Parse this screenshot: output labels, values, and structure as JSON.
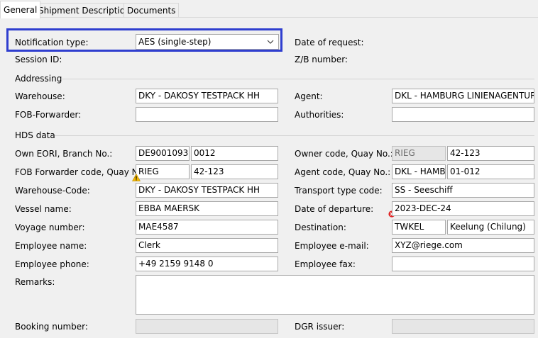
{
  "tabs": [
    {
      "label": "General"
    },
    {
      "label": "Shipment Description"
    },
    {
      "label": "Documents"
    }
  ],
  "header": {
    "notification_type_label": "Notification type:",
    "notification_type_value": "AES (single-step)",
    "session_id_label": "Session ID:",
    "date_of_request_label": "Date of request:",
    "zb_number_label": "Z/B number:"
  },
  "addressing": {
    "section_title": "Addressing",
    "warehouse_label": "Warehouse:",
    "warehouse_value": "DKY - DAKOSY TESTPACK HH",
    "agent_label": "Agent:",
    "agent_value": "DKL - HAMBURG LINIENAGENTUR (T",
    "fob_forwarder_label": "FOB-Forwarder:",
    "fob_forwarder_value": "",
    "authorities_label": "Authorities:",
    "authorities_value": ""
  },
  "hds": {
    "section_title": "HDS data",
    "own_eori_label": "Own EORI, Branch No.:",
    "own_eori_value": "DE9001093",
    "own_branch_value": "0012",
    "owner_code_label": "Owner code, Quay No.:",
    "owner_code_value": "RIEG",
    "owner_quay_value": "42-123",
    "fob_code_label": "FOB Forwarder code, Quay No.:",
    "fob_code_value": "RIEG",
    "fob_quay_value": "42-123",
    "agent_code_label": "Agent code, Quay No.:",
    "agent_code_value": "DKL - HAMB",
    "agent_quay_value": "01-012",
    "warehouse_code_label": "Warehouse-Code:",
    "warehouse_code_value": "DKY - DAKOSY TESTPACK HH",
    "transport_type_label": "Transport type code:",
    "transport_type_value": "SS - Seeschiff",
    "vessel_name_label": "Vessel name:",
    "vessel_name_value": "EBBA MAERSK",
    "date_of_departure_label": "Date of departure:",
    "date_of_departure_value": "2023-DEC-24",
    "voyage_number_label": "Voyage number:",
    "voyage_number_value": "MAE4587",
    "destination_label": "Destination:",
    "destination_code_value": "TWKEL",
    "destination_name_value": "Keelung (Chilung)",
    "employee_name_label": "Employee name:",
    "employee_name_value": "Clerk",
    "employee_email_label": "Employee e-mail:",
    "employee_email_value": "XYZ@riege.com",
    "employee_phone_label": "Employee phone:",
    "employee_phone_value": "+49 2159 9148 0",
    "employee_fax_label": "Employee fax:",
    "employee_fax_value": "",
    "remarks_label": "Remarks:",
    "remarks_value": "",
    "booking_number_label": "Booking number:",
    "booking_number_value": "",
    "dgr_issuer_label": "DGR issuer:",
    "dgr_issuer_value": ""
  },
  "icons": {
    "dropdown": "chevron-down-icon",
    "warning": "warning-triangle-icon",
    "error": "error-circle-icon"
  },
  "colors": {
    "highlight": "#2f3ecf",
    "warning": "#f2b600",
    "error": "#e02424"
  }
}
